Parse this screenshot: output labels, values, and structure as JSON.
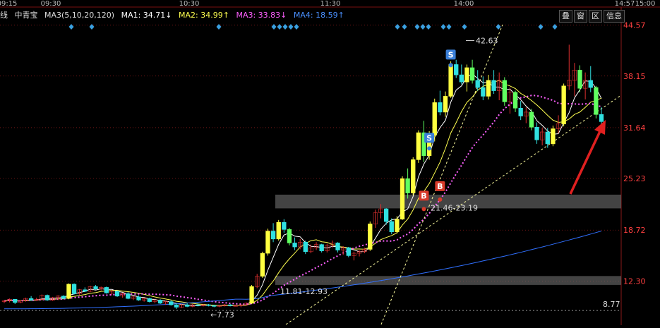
{
  "time_axis": [
    "09:15",
    "09:30",
    "10:30",
    "11:30",
    "14:00",
    "14:57",
    "15:00"
  ],
  "header": {
    "prefix": "线",
    "stock": "中青宝",
    "ma_def": "MA3(5,10,20,120)",
    "ma1": "MA1: 34.71↓",
    "ma2": "MA2: 34.99↑",
    "ma3": "MA3: 33.83↓",
    "ma4": "MA4: 18.59↑"
  },
  "buttons": [
    "叠",
    "窗",
    "区",
    "信息"
  ],
  "colors": {
    "up": "#e03030",
    "down": "#30e0e0",
    "yellow": "#ffff40",
    "green": "#60ff60",
    "ma1": "#ffffff",
    "ma2": "#ffff50",
    "ma3": "#ff60ff",
    "ma4": "#3070ff",
    "grid": "#8a1a1a",
    "axis_text": "#ff4040",
    "arrow": "#e02020"
  },
  "chart_data": {
    "type": "candlestick",
    "y_ticks": [
      "44.57",
      "38.15",
      "31.64",
      "25.23",
      "18.72",
      "12.30"
    ],
    "ylim": [
      8.6,
      44.8
    ],
    "candles": [
      [
        9.7,
        9.9,
        9.5,
        9.8
      ],
      [
        9.8,
        10.1,
        9.6,
        10.0
      ],
      [
        10.0,
        10.0,
        9.4,
        9.6
      ],
      [
        9.6,
        9.9,
        9.5,
        9.8
      ],
      [
        9.8,
        10.2,
        9.7,
        10.1
      ],
      [
        10.1,
        10.4,
        9.8,
        9.9
      ],
      [
        9.9,
        10.2,
        9.8,
        10.0
      ],
      [
        10.0,
        10.6,
        9.9,
        10.5
      ],
      [
        10.5,
        10.6,
        9.8,
        9.9
      ],
      [
        9.9,
        10.3,
        9.8,
        10.2
      ],
      [
        10.2,
        10.5,
        9.9,
        10.4
      ],
      [
        10.4,
        10.5,
        10.0,
        10.1
      ],
      [
        10.1,
        12.0,
        10.0,
        11.9
      ],
      [
        11.9,
        12.0,
        10.6,
        10.7
      ],
      [
        10.7,
        11.3,
        10.5,
        11.2
      ],
      [
        11.2,
        11.5,
        10.9,
        11.0
      ],
      [
        11.0,
        11.7,
        10.9,
        11.6
      ],
      [
        11.6,
        11.8,
        11.2,
        11.3
      ],
      [
        11.3,
        11.6,
        11.1,
        11.5
      ],
      [
        11.5,
        11.6,
        10.7,
        10.8
      ],
      [
        10.8,
        11.2,
        10.5,
        11.0
      ],
      [
        11.0,
        11.1,
        10.3,
        10.4
      ],
      [
        10.4,
        10.8,
        10.2,
        10.7
      ],
      [
        10.7,
        10.9,
        10.0,
        10.1
      ],
      [
        10.1,
        10.4,
        9.9,
        10.3
      ],
      [
        10.3,
        10.5,
        9.8,
        9.9
      ],
      [
        9.9,
        10.2,
        9.7,
        10.1
      ],
      [
        10.1,
        10.2,
        9.6,
        9.7
      ],
      [
        9.7,
        10.0,
        9.5,
        9.9
      ],
      [
        9.9,
        10.0,
        9.4,
        9.5
      ],
      [
        9.5,
        9.8,
        9.3,
        9.7
      ],
      [
        9.7,
        9.9,
        9.2,
        9.3
      ],
      [
        9.3,
        9.5,
        8.77,
        9.0
      ],
      [
        9.0,
        9.4,
        8.9,
        9.3
      ],
      [
        9.3,
        9.5,
        9.0,
        9.1
      ],
      [
        9.1,
        9.4,
        9.0,
        9.3
      ],
      [
        9.3,
        9.5,
        9.1,
        9.2
      ],
      [
        9.2,
        9.4,
        9.1,
        9.3
      ],
      [
        9.3,
        9.4,
        9.1,
        9.2
      ],
      [
        9.2,
        9.3,
        9.0,
        9.1
      ],
      [
        9.1,
        9.3,
        9.0,
        9.2
      ],
      [
        9.2,
        9.4,
        9.1,
        9.3
      ],
      [
        9.3,
        9.4,
        9.1,
        9.2
      ],
      [
        9.2,
        9.3,
        9.1,
        9.2
      ],
      [
        9.2,
        9.3,
        9.0,
        9.3
      ],
      [
        9.3,
        9.6,
        9.2,
        9.5
      ],
      [
        9.5,
        11.8,
        9.4,
        11.6
      ],
      [
        11.6,
        13.2,
        11.4,
        12.9
      ],
      [
        12.9,
        16.0,
        12.7,
        15.8
      ],
      [
        15.8,
        18.9,
        15.5,
        18.6
      ],
      [
        18.6,
        19.6,
        17.2,
        17.6
      ],
      [
        17.6,
        20.0,
        17.4,
        19.7
      ],
      [
        19.7,
        20.1,
        18.4,
        18.8
      ],
      [
        18.8,
        19.0,
        16.8,
        17.1
      ],
      [
        17.1,
        17.8,
        16.2,
        16.6
      ],
      [
        16.6,
        17.6,
        16.3,
        17.2
      ],
      [
        17.2,
        17.4,
        15.7,
        16.0
      ],
      [
        16.0,
        16.9,
        15.8,
        16.5
      ],
      [
        16.5,
        17.2,
        16.2,
        16.9
      ],
      [
        16.9,
        17.0,
        15.9,
        16.1
      ],
      [
        16.1,
        17.0,
        15.9,
        16.8
      ],
      [
        16.8,
        17.4,
        16.5,
        17.1
      ],
      [
        17.1,
        17.2,
        15.9,
        16.2
      ],
      [
        16.2,
        16.7,
        15.6,
        16.5
      ],
      [
        16.5,
        16.6,
        15.3,
        15.5
      ],
      [
        15.5,
        16.0,
        14.9,
        15.8
      ],
      [
        15.8,
        16.2,
        15.4,
        16.0
      ],
      [
        16.0,
        16.5,
        15.8,
        16.3
      ],
      [
        16.3,
        19.8,
        16.1,
        19.5
      ],
      [
        19.5,
        21.3,
        19.0,
        20.9
      ],
      [
        20.9,
        22.0,
        20.2,
        21.4
      ],
      [
        21.4,
        21.5,
        19.4,
        19.8
      ],
      [
        19.8,
        20.2,
        18.2,
        18.5
      ],
      [
        18.5,
        20.5,
        18.3,
        20.1
      ],
      [
        20.1,
        25.5,
        20.0,
        25.2
      ],
      [
        25.2,
        26.5,
        22.7,
        23.4
      ],
      [
        23.4,
        27.9,
        23.1,
        27.6
      ],
      [
        27.6,
        31.3,
        27.2,
        31.0
      ],
      [
        31.0,
        32.5,
        27.3,
        28.1
      ],
      [
        28.1,
        31.2,
        27.6,
        30.7
      ],
      [
        30.7,
        35.3,
        29.9,
        34.8
      ],
      [
        34.8,
        36.3,
        33.2,
        33.6
      ],
      [
        33.6,
        36.2,
        33.0,
        35.6
      ],
      [
        35.6,
        40.0,
        35.4,
        39.6
      ],
      [
        39.6,
        40.2,
        37.9,
        38.3
      ],
      [
        38.3,
        39.6,
        37.1,
        37.4
      ],
      [
        37.4,
        39.6,
        36.2,
        39.2
      ],
      [
        39.2,
        40.2,
        37.2,
        37.6
      ],
      [
        37.6,
        38.9,
        36.3,
        36.7
      ],
      [
        36.7,
        38.1,
        35.1,
        35.6
      ],
      [
        35.6,
        38.3,
        35.2,
        37.6
      ],
      [
        37.6,
        38.9,
        35.9,
        36.3
      ],
      [
        36.3,
        38.6,
        35.1,
        37.6
      ],
      [
        37.6,
        38.0,
        34.4,
        34.9
      ],
      [
        34.9,
        36.7,
        33.4,
        36.1
      ],
      [
        36.1,
        36.3,
        33.6,
        34.1
      ],
      [
        34.1,
        35.0,
        32.6,
        33.1
      ],
      [
        33.1,
        34.2,
        32.2,
        33.6
      ],
      [
        33.6,
        34.0,
        31.3,
        31.7
      ],
      [
        31.7,
        32.3,
        29.6,
        30.1
      ],
      [
        30.1,
        31.6,
        29.4,
        31.1
      ],
      [
        31.1,
        31.6,
        29.1,
        29.6
      ],
      [
        29.6,
        31.9,
        29.3,
        31.5
      ],
      [
        31.5,
        33.2,
        30.9,
        32.1
      ],
      [
        32.1,
        37.2,
        31.8,
        36.9
      ],
      [
        36.9,
        42.1,
        36.4,
        37.6
      ],
      [
        37.6,
        39.8,
        35.6,
        38.9
      ],
      [
        38.9,
        39.5,
        36.1,
        36.6
      ],
      [
        36.6,
        38.6,
        35.2,
        37.6
      ],
      [
        37.6,
        39.4,
        36.1,
        36.7
      ],
      [
        36.7,
        36.9,
        32.8,
        33.3
      ],
      [
        33.3,
        34.2,
        31.9,
        32.4
      ]
    ],
    "markers": [
      {
        "type": "S",
        "index": 83,
        "price": 38.1
      },
      {
        "type": "S",
        "index": 79,
        "price": 27.6
      },
      {
        "type": "B",
        "index": 81,
        "price": 24.0
      },
      {
        "type": "B",
        "index": 78,
        "price": 22.8
      }
    ],
    "annotations": [
      "42.63",
      "8.77",
      "7.73",
      "11.81-12.93",
      "21.46-23.19"
    ],
    "zones": [
      {
        "label": "11.81-12.93",
        "low": 11.81,
        "high": 12.93
      },
      {
        "label": "21.46-23.19",
        "low": 21.46,
        "high": 23.19
      }
    ]
  }
}
